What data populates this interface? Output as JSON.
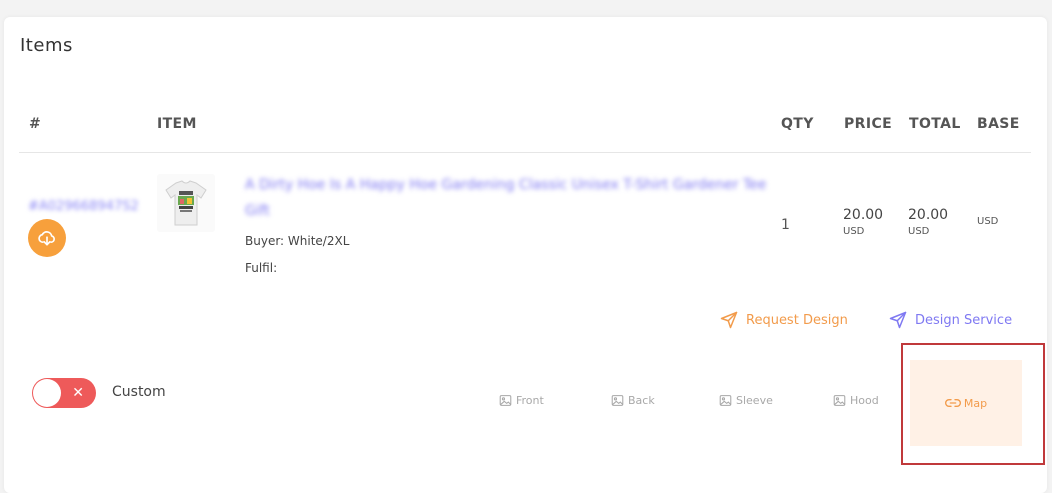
{
  "section_title": "Items",
  "columns": {
    "index": "#",
    "item": "ITEM",
    "qty": "QTY",
    "price": "PRICE",
    "total": "TOTAL",
    "base": "BASE"
  },
  "row": {
    "order_id": "#A029668947S2",
    "product_title": "A Dirty Hoe Is A Happy Hoe Gardening Classic Unisex T-Shirt Gardener Tee Gift",
    "buyer": "Buyer: White/2XL",
    "fulfil": "Fulfil:",
    "qty": "1",
    "price": "20.00",
    "price_currency": "USD",
    "total": "20.00",
    "total_currency": "USD",
    "base_currency": "USD",
    "thumbnail_text": "A DIRTY HOE IS A HAPPY HOE"
  },
  "actions": {
    "request_design": "Request Design",
    "design_service": "Design Service"
  },
  "custom": {
    "label": "Custom",
    "enabled": false
  },
  "print_slots": {
    "front": "Front",
    "back": "Back",
    "sleeve": "Sleeve",
    "hood": "Hood",
    "map": "Map"
  },
  "colors": {
    "accent_orange": "#f7a03c",
    "link_purple": "#7f79f2",
    "toggle_red": "#ee5a5a",
    "map_bg": "#fff1e6",
    "highlight": "#c0393b"
  }
}
